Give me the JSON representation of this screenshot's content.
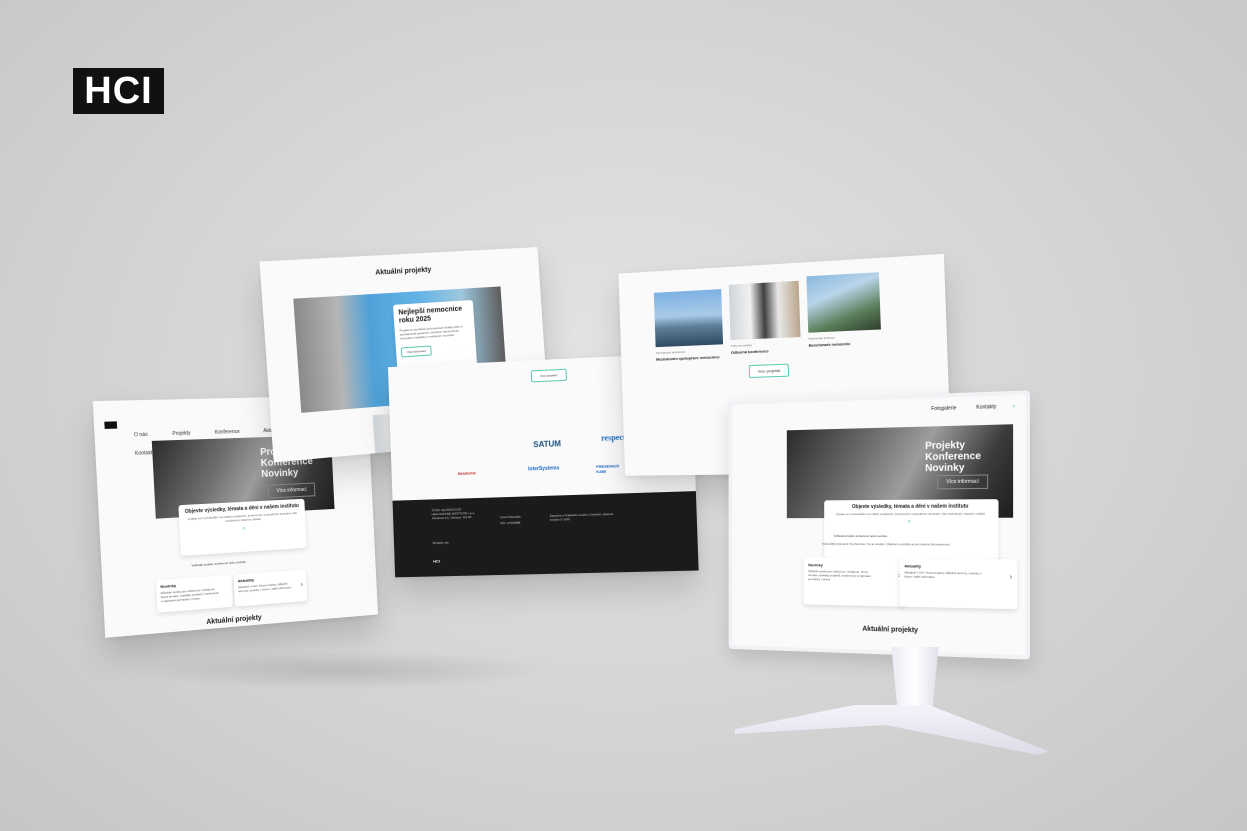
{
  "brand": {
    "logo_text": "HCI"
  },
  "nav": {
    "items": [
      "O nás",
      "Projekty",
      "Konference",
      "Aktuality",
      "Fotogalerie",
      "Kontakty"
    ]
  },
  "hero": {
    "title": "Projekty Konference Novinky",
    "button": "Více informací"
  },
  "intro": {
    "heading": "Objevte výsledky, témata a dění v našem institutu",
    "subtitle": "Vydejte se k přehledům na našich projektech, konferenční a aktuálních zprávách. Dle nosilněným vlastním vkladů.",
    "link": "Vyhledat projekt, konferenci nebo novinku",
    "note": "Nejnovější propojení (Konference / Co je nového / Ukázky) a využijte je pro budoucí (kompetence)."
  },
  "news_cards": [
    {
      "title": "Novinky",
      "text": "Důležité zprávy pro odbornou i veřejnost. Nová témata, výsledky projektů, konference a zajímavé pozvánky z praxe."
    },
    {
      "title": "Aktuality",
      "text": "Aktuálně v HCI. Nové projekty, důležité termíny, novinky v oboru i další informace."
    }
  ],
  "section_titles": {
    "projects": "Aktuální projekty"
  },
  "featured_project": {
    "title": "Nejlepší nemocnice roku 2025",
    "text": "Projekt se zaměřuje na hodnocení kvality péče a spokojenosti pacientů v českých nemocnicích. Kompletní výsledky a zveřejnění na webu.",
    "button": "Více informací"
  },
  "project_cards": [
    {
      "caption": "Mezinárodní spolupráce",
      "title": "Mezinárodní spolupráce nemocnice"
    },
    {
      "caption": "Odborné setkání",
      "title": "Odborná konference"
    },
    {
      "caption": "Partnerské instituce",
      "title": "Benchmark nemocnic"
    }
  ],
  "more_projects_button": "Více projektů",
  "partners": [
    "SATUM",
    "respect.",
    "InterSystems",
    "FRESENIUS KABI",
    "Akademie"
  ],
  "footer": {
    "sidlo_label": "Sídlo společnosti",
    "sidlo_text": "HEALTHCARE INSTITUTE o.p.s.",
    "address": "Jiráskova 1/1, Ostrava, 702 00",
    "country_label": "Czech Republic",
    "ico": "IČO: 27933888",
    "registry": "Zapsána u Krajského soudu v Ostravě, spisová značka O 1242",
    "follow_label": "Sledujte nás",
    "brand_small": "HCI"
  },
  "colors": {
    "accent_teal": "#59c9b3",
    "brand_black": "#111111",
    "satum_blue": "#1d4f7a",
    "respect_blue": "#1565c0",
    "partner_red": "#c62828"
  }
}
